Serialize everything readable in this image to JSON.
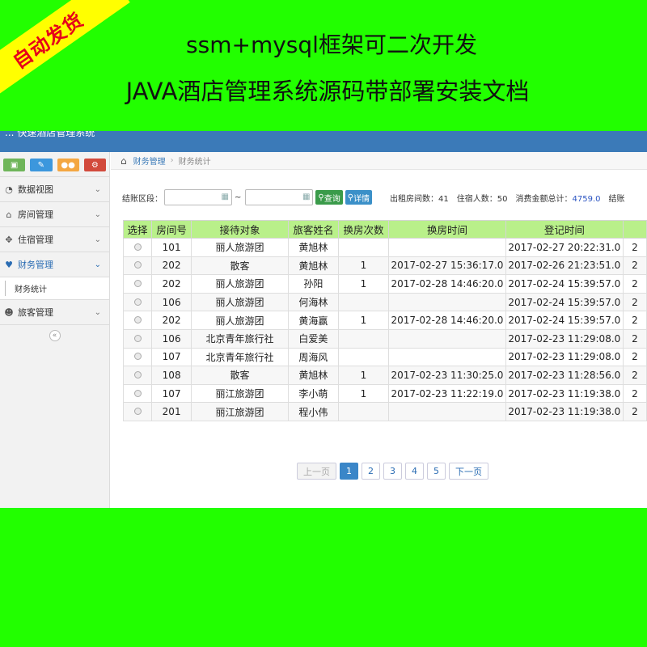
{
  "banner": {
    "ribbon": "自动发货",
    "line1": "ssm+mysql框架可二次开发",
    "line2": "JAVA酒店管理系统源码带部署安装文档"
  },
  "app": {
    "title": "... 快速酒店管理系统"
  },
  "colors": {
    "background": "#22ff00",
    "ribbon": "#ffff00",
    "ribbon_text": "#e6001a",
    "table_header": "#b9f08a",
    "accent": "#3a86c8"
  },
  "sidebar": {
    "shortcuts": [
      {
        "icon": "signal-icon",
        "color": "#6fb55a"
      },
      {
        "icon": "pencil-icon",
        "color": "#3c97dd"
      },
      {
        "icon": "users-icon",
        "color": "#f4a742"
      },
      {
        "icon": "cogs-icon",
        "color": "#d24a3c"
      }
    ],
    "items": [
      {
        "label": "数据视图",
        "icon": "dashboard-icon"
      },
      {
        "label": "房间管理",
        "icon": "home-icon"
      },
      {
        "label": "住宿管理",
        "icon": "move-icon"
      },
      {
        "label": "财务管理",
        "icon": "heart-icon",
        "active": true
      },
      {
        "label": "旅客管理",
        "icon": "user-icon"
      }
    ],
    "subitem": "财务统计",
    "collapse": "«"
  },
  "breadcrumb": {
    "home_icon": "home-icon",
    "level1": "财务管理",
    "level2": "财务统计"
  },
  "filter": {
    "label": "结账区段：",
    "start_value": "",
    "end_value": "",
    "tilde": "~",
    "query_button": "查询",
    "detail_button": "详情",
    "rented_label": "出租房间数：",
    "rented_value": "41",
    "guests_label": "住宿人数：",
    "guests_value": "50",
    "total_label": "消费金额总计：",
    "total_value": "4759.0",
    "cutoff": "结账"
  },
  "table": {
    "headers": [
      "选择",
      "房间号",
      "接待对象",
      "旅客姓名",
      "换房次数",
      "换房时间",
      "登记时间",
      ""
    ],
    "rows": [
      [
        "",
        "101",
        "丽人旅游团",
        "黄旭林",
        "",
        "",
        "2017-02-27 20:22:31.0",
        "2"
      ],
      [
        "",
        "202",
        "散客",
        "黄旭林",
        "1",
        "2017-02-27 15:36:17.0",
        "2017-02-26 21:23:51.0",
        "2"
      ],
      [
        "",
        "202",
        "丽人旅游团",
        "孙阳",
        "1",
        "2017-02-28 14:46:20.0",
        "2017-02-24 15:39:57.0",
        "2"
      ],
      [
        "",
        "106",
        "丽人旅游团",
        "何海林",
        "",
        "",
        "2017-02-24 15:39:57.0",
        "2"
      ],
      [
        "",
        "202",
        "丽人旅游团",
        "黄海赢",
        "1",
        "2017-02-28 14:46:20.0",
        "2017-02-24 15:39:57.0",
        "2"
      ],
      [
        "",
        "106",
        "北京青年旅行社",
        "白爱美",
        "",
        "",
        "2017-02-23 11:29:08.0",
        "2"
      ],
      [
        "",
        "107",
        "北京青年旅行社",
        "周海风",
        "",
        "",
        "2017-02-23 11:29:08.0",
        "2"
      ],
      [
        "",
        "108",
        "散客",
        "黄旭林",
        "1",
        "2017-02-23 11:30:25.0",
        "2017-02-23 11:28:56.0",
        "2"
      ],
      [
        "",
        "107",
        "丽江旅游团",
        "李小萌",
        "1",
        "2017-02-23 11:22:19.0",
        "2017-02-23 11:19:38.0",
        "2"
      ],
      [
        "",
        "201",
        "丽江旅游团",
        "程小伟",
        "",
        "",
        "2017-02-23 11:19:38.0",
        "2"
      ]
    ]
  },
  "pager": {
    "prev": "上一页",
    "pages": [
      "1",
      "2",
      "3",
      "4",
      "5"
    ],
    "current": "1",
    "next": "下一页"
  }
}
